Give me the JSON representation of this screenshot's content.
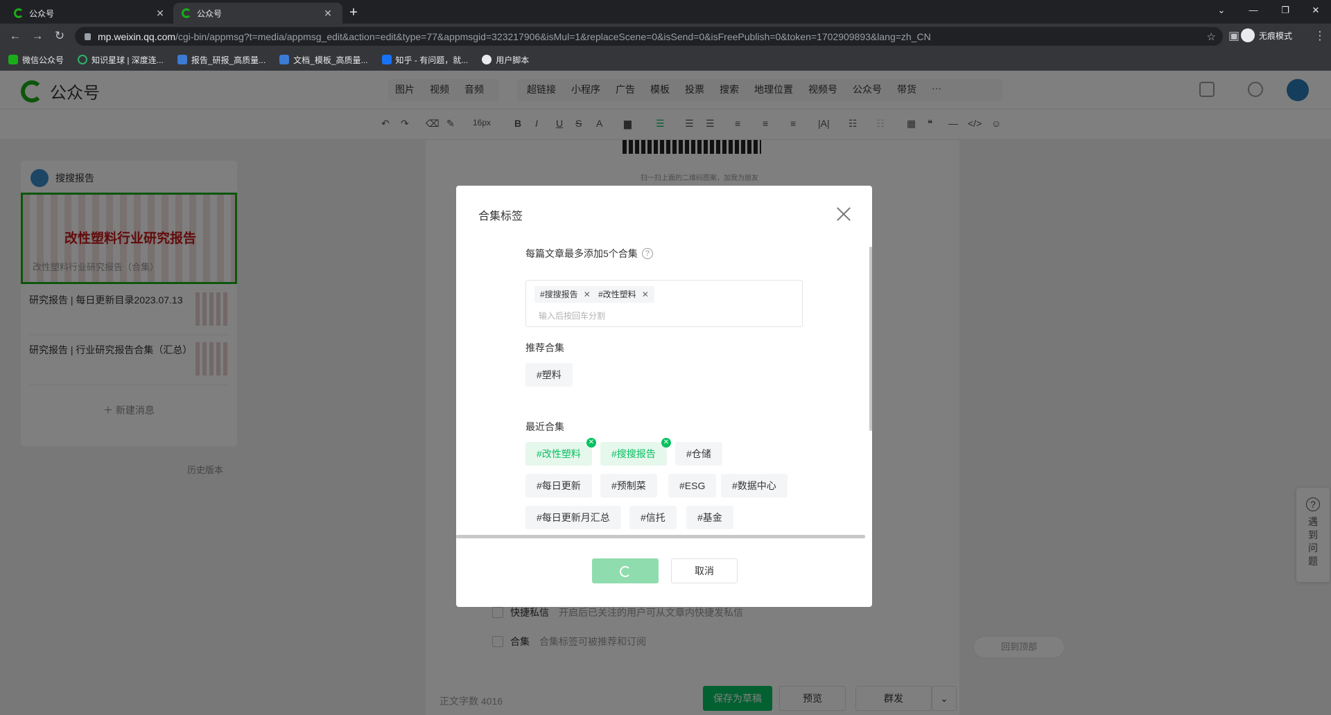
{
  "browser": {
    "tabs": [
      {
        "title": "公众号",
        "active": false
      },
      {
        "title": "公众号",
        "active": true
      }
    ],
    "url_host": "mp.weixin.qq.com",
    "url_path": "/cgi-bin/appmsg?t=media/appmsg_edit&action=edit&type=77&appmsgid=323217906&isMul=1&replaceScene=0&isSend=0&isFreePublish=0&token=1702909893&lang=zh_CN",
    "incognito_label": "无痕模式",
    "bookmarks": [
      "微信公众号",
      "知识星球 | 深度连...",
      "报告_研报_高质量...",
      "文档_模板_高质量...",
      "知乎 - 有问题，就...",
      "用户脚本"
    ]
  },
  "header": {
    "logo_text": "公众号",
    "media_menu": [
      "图片",
      "视频",
      "音频"
    ],
    "insert_menu": [
      "超链接",
      "小程序",
      "广告",
      "模板",
      "投票",
      "搜索",
      "地理位置",
      "视频号",
      "公众号",
      "带货"
    ],
    "more": "···"
  },
  "toolbar": {
    "font_size": "16px"
  },
  "sidebar": {
    "account_name": "搜搜报告",
    "cover_title": "改性塑料行业研究报告",
    "cover_subtitle": "改性塑料行业研究报告（合集）",
    "articles": [
      {
        "title": "研究报告 | 每日更新目录2023.07.13"
      },
      {
        "title": "研究报告 | 行业研究报告合集（汇总）"
      }
    ],
    "new_message": "＋ 新建消息",
    "history": "历史版本"
  },
  "editor": {
    "qr_caption": "扫一扫上面的二维码图案，加我为朋友",
    "quick_msg_label": "快捷私信",
    "quick_msg_desc": "开启后已关注的用户可从文章内快捷发私信",
    "collection_label": "合集",
    "collection_desc": "合集标签可被推荐和订阅",
    "word_count_label": "正文字数",
    "word_count": "4016",
    "save_draft": "保存为草稿",
    "preview": "预览",
    "publish": "群发"
  },
  "help": {
    "label": "遇到问题"
  },
  "back_to_top": "回到顶部",
  "dialog": {
    "title": "合集标签",
    "limit_label": "每篇文章最多添加5个合集",
    "selected_tags": [
      "#搜搜报告",
      "#改性塑料"
    ],
    "input_placeholder": "输入后按回车分割",
    "recommended_label": "推荐合集",
    "recommended": [
      "#塑料"
    ],
    "recent_label": "最近合集",
    "recent": [
      {
        "label": "#改性塑料",
        "selected": true
      },
      {
        "label": "#搜搜报告",
        "selected": true
      },
      {
        "label": "#仓储",
        "selected": false
      },
      {
        "label": "#每日更新",
        "selected": false
      },
      {
        "label": "#预制菜",
        "selected": false
      },
      {
        "label": "#ESG",
        "selected": false
      },
      {
        "label": "#数据中心",
        "selected": false
      },
      {
        "label": "#每日更新月汇总",
        "selected": false
      },
      {
        "label": "#信托",
        "selected": false
      },
      {
        "label": "#基金",
        "selected": false
      }
    ],
    "cancel": "取消"
  },
  "colors": {
    "brand_green": "#07c160",
    "logo_green": "#1aad19"
  }
}
